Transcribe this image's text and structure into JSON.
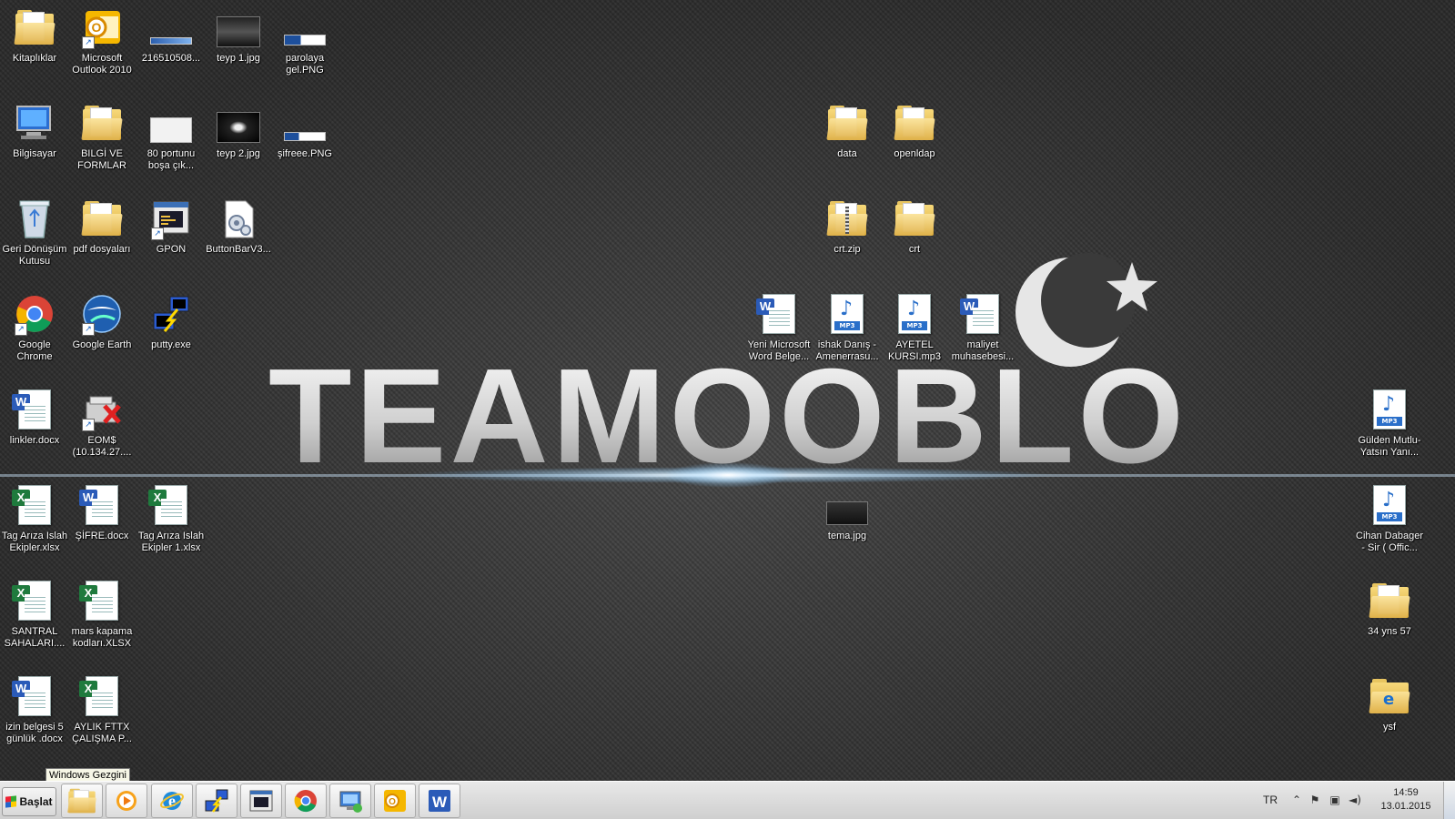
{
  "wallpaper": {
    "logo_text": "TEAMOOBLO",
    "accent": "#e8e8e8"
  },
  "desktop": {
    "icons": {
      "kitapliklar": "Kitaplıklar",
      "outlook": "Microsoft Outlook 2010",
      "img_216510508": "216510508...",
      "teyp1": "teyp 1.jpg",
      "parolaya": "parolaya gel.PNG",
      "bilgisayar": "Bilgisayar",
      "bilgi_formlar": "BILGİ VE FORMLAR",
      "port80": "80 portunu boşa çık...",
      "teyp2": "teyp 2.jpg",
      "sifreee": "şifreee.PNG",
      "data": "data",
      "openldap": "openldap",
      "geri_donusum": "Geri Dönüşüm Kutusu",
      "pdf": "pdf dosyaları",
      "gpon": "GPON",
      "buttonbar": "ButtonBarV3...",
      "crtzip": "crt.zip",
      "crt": "crt",
      "chrome": "Google Chrome",
      "earth": "Google Earth",
      "putty": "putty.exe",
      "yeni_word": "Yeni Microsoft Word Belge...",
      "ishak": "ishak Danış - Amenerrasu...",
      "ayetel": "AYETEL KURSI.mp3",
      "maliyet": "maliyet muhasebesi...",
      "linkler": "linkler.docx",
      "eoms": "EOM$ (10.134.27....",
      "gulden": "Gülden Mutlu-Yatsın Yanı...",
      "tag1": "Tag Arıza Islah Ekipler.xlsx",
      "sifre": "ŞİFRE.docx",
      "tag2": "Tag Arıza Islah Ekipler 1.xlsx",
      "tema": "tema.jpg",
      "cihan": "Cihan Dabager - Sir ( Offic...",
      "santral": "SANTRAL SAHALARI....",
      "mars": "mars kapama kodları.XLSX",
      "yns57": "34 yns 57",
      "izin": "izin belgesi 5 günlük .docx",
      "aylik": "AYLIK FTTX ÇALIŞMA P...",
      "ysf": "ysf"
    }
  },
  "tooltip": "Windows Gezgini",
  "taskbar": {
    "start_label": "Başlat",
    "pinned": [
      "windows-explorer",
      "media-player",
      "internet-explorer",
      "putty",
      "gpon-app",
      "google-chrome",
      "remote-desktop",
      "outlook",
      "word"
    ],
    "language": "TR",
    "time": "14:59",
    "date": "13.01.2015"
  }
}
